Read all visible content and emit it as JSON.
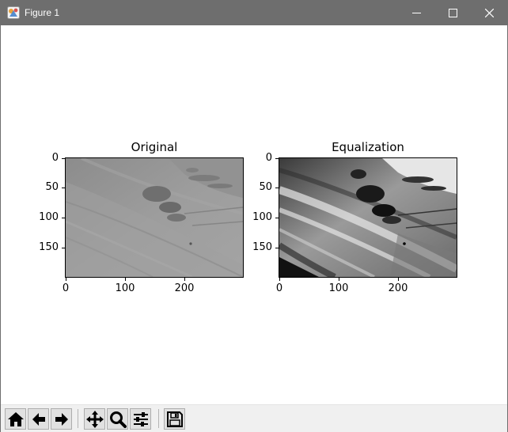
{
  "window": {
    "title": "Figure 1"
  },
  "icons": {
    "app": "matplotlib-figure-icon",
    "minimize": "minimize-icon",
    "maximize": "maximize-icon",
    "close": "close-icon"
  },
  "colors": {
    "titlebar": "#6e6e6e",
    "toolbar": "#f0f0f0",
    "figure_bg": "#ffffff"
  },
  "chart_data": [
    {
      "type": "image",
      "title": "Original",
      "xticks": [
        "0",
        "100",
        "200"
      ],
      "yticks": [
        "0",
        "50",
        "100",
        "150"
      ],
      "xlim": [
        0,
        299
      ],
      "ylim": [
        199,
        0
      ],
      "colormap": "gray",
      "content": "low-contrast grayscale photo of grassy hillside"
    },
    {
      "type": "image",
      "title": "Equalization",
      "xticks": [
        "0",
        "100",
        "200"
      ],
      "yticks": [
        "0",
        "50",
        "100",
        "150"
      ],
      "xlim": [
        0,
        299
      ],
      "ylim": [
        199,
        0
      ],
      "colormap": "gray",
      "content": "histogram-equalized high-contrast grayscale hillside"
    }
  ],
  "toolbar": {
    "buttons": [
      {
        "name": "home-button",
        "icon": "home-icon"
      },
      {
        "name": "back-button",
        "icon": "arrow-left-icon"
      },
      {
        "name": "forward-button",
        "icon": "arrow-right-icon"
      },
      {
        "name": "pan-button",
        "icon": "move-icon"
      },
      {
        "name": "zoom-button",
        "icon": "magnifier-icon"
      },
      {
        "name": "configure-subplots-button",
        "icon": "sliders-icon"
      },
      {
        "name": "save-button",
        "icon": "floppy-disk-icon"
      }
    ]
  }
}
